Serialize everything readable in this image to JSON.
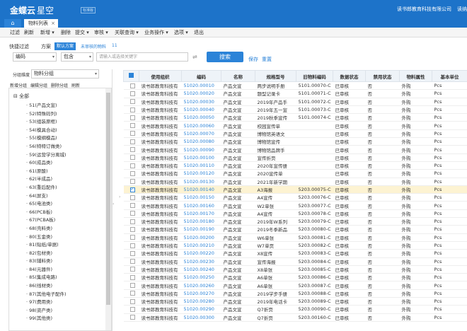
{
  "app": {
    "name": "金蝶云",
    "product": "星空",
    "badge": "标准版",
    "company": "读书郎教育科技有限公司",
    "user": "读纳"
  },
  "tabs": {
    "home": "⌂",
    "active": "物料列表",
    "close": "×"
  },
  "toolbar": [
    "过滤",
    "刷新",
    "新增 ▾",
    "删除",
    "提交 ▾",
    "审核 ▾",
    "关联查询 ▾",
    "业务操作 ▾",
    "选项 ▾",
    "退出"
  ],
  "filter": {
    "quick_filter": "快捷过滤",
    "scheme": "方案",
    "default_scheme": "默认方案",
    "unaudited": "未审核的物料",
    "count": "11",
    "field": "编码",
    "operator": "包含",
    "placeholder": "请输入或选择关键字",
    "search_button": "搜索",
    "save": "保存",
    "reset": "重置"
  },
  "left_panel": {
    "group_label": "分组维度",
    "group_value": "物料分组",
    "actions": [
      "新增分组",
      "编辑分组",
      "删除分组",
      "刷新"
    ],
    "root": "全部",
    "items": [
      "51(产品文宣)",
      "52(特殊码列)",
      "53(组装原框)",
      "54(模具合动)",
      "55(模纲模品)",
      "56(特特订做类)",
      "59(运营学分离城)",
      "60(成品类)",
      "61(原酸)",
      "62(半成品)",
      "63(重后配件)",
      "64(屏支)",
      "65(电池类)",
      "66(PCB板)",
      "67(PCBA板)",
      "68(壳料类)",
      "80(五金类)",
      "81(贴纸/单据)",
      "82(包材类)",
      "83(辅料类)",
      "84(元器件)",
      "85(集成电路)",
      "86(线材类)",
      "87(其他电子配件)",
      "97(费用类)",
      "98(资产类)",
      "99(其他类)"
    ]
  },
  "table": {
    "columns": [
      "",
      "使用组织",
      "编码",
      "名称",
      "规格型号",
      "旧物料编码",
      "数据状态",
      "禁用状态",
      "物料属性",
      "基本单位"
    ],
    "rows": [
      [
        "读书郎教育科技有",
        "51020.00010",
        "产品文宣",
        "两步说明手册",
        "5101.00070-C",
        "已审核",
        "否",
        "外购",
        "Pcs"
      ],
      [
        "读书郎教育科技有",
        "51020.00020",
        "产品文宣",
        "题型记录卡",
        "5101.00071-C",
        "已审核",
        "否",
        "外购",
        "Pcs"
      ],
      [
        "读书郎教育科技有",
        "51020.00030",
        "产品文宣",
        "2019年产品手",
        "5101.00072-C",
        "已审核",
        "否",
        "外购",
        "Pcs"
      ],
      [
        "读书郎教育科技有",
        "51020.00040",
        "产品文宣",
        "2019年五一宣",
        "5101.00073-C",
        "已审核",
        "否",
        "外购",
        "Pcs"
      ],
      [
        "读书郎教育科技有",
        "51020.00050",
        "产品文宣",
        "2019秋季宣传",
        "5101.00074-C",
        "已审核",
        "否",
        "外购",
        "Pcs"
      ],
      [
        "读书郎教育科技有",
        "51020.00060",
        "产品文宣",
        "校园宣传单",
        "",
        "已审核",
        "否",
        "外购",
        "Pcs"
      ],
      [
        "读书郎教育科技有",
        "51020.00070",
        "产品文宣",
        "博物馆英语文",
        "",
        "已审核",
        "否",
        "外购",
        "Pcs"
      ],
      [
        "读书郎教育科技有",
        "51020.00080",
        "产品文宣",
        "博物馆宣传",
        "",
        "已审核",
        "否",
        "外购",
        "Pcs"
      ],
      [
        "读书郎教育科技有",
        "51020.00090",
        "产品文宣",
        "博物馆品牌手",
        "",
        "已审核",
        "否",
        "外购",
        "Pcs"
      ],
      [
        "读书郎教育科技有",
        "51020.00100",
        "产品文宣",
        "宣传折页",
        "",
        "已审核",
        "否",
        "外购",
        "Pcs"
      ],
      [
        "读书郎教育科技有",
        "51020.00110",
        "产品文宣",
        "2020年宣传册",
        "",
        "已审核",
        "否",
        "外购",
        "Pcs"
      ],
      [
        "读书郎教育科技有",
        "51020.00120",
        "产品文宣",
        "2020宣传单",
        "",
        "已审核",
        "否",
        "外购",
        "Pcs"
      ],
      [
        "读书郎教育科技有",
        "51020.00130",
        "产品文宣",
        "2021年新学期",
        "",
        "已审核",
        "否",
        "外购",
        "Pcs"
      ],
      [
        "读书郎教育科技有",
        "51020.00140",
        "产品文宣",
        "A3海报",
        "5203.00075-C",
        "已审核",
        "否",
        "外购",
        "Pcs"
      ],
      [
        "读书郎教育科技有",
        "51020.00150",
        "产品文宣",
        "A4宣传",
        "5203.00076-C",
        "已审核",
        "否",
        "外购",
        "Pcs"
      ],
      [
        "读书郎教育科技有",
        "51020.00160",
        "产品文宣",
        "W2单张",
        "5203.00077-C",
        "已审核",
        "否",
        "外购",
        "Pcs"
      ],
      [
        "读书郎教育科技有",
        "51020.00170",
        "产品文宣",
        "A4宣传",
        "5203.00078-C",
        "已审核",
        "否",
        "外购",
        "Pcs"
      ],
      [
        "读书郎教育科技有",
        "51020.00180",
        "产品文宣",
        "2019年W系列",
        "5203.00079-C",
        "已审核",
        "否",
        "外购",
        "Pcs"
      ],
      [
        "读书郎教育科技有",
        "51020.00190",
        "产品文宣",
        "2019冬季新品",
        "5203.00080-C",
        "已审核",
        "否",
        "外购",
        "Pcs"
      ],
      [
        "读书郎教育科技有",
        "51020.00200",
        "产品文宣",
        "W6单张",
        "5203.00081-C",
        "已审核",
        "否",
        "外购",
        "Pcs"
      ],
      [
        "读书郎教育科技有",
        "51020.00210",
        "产品文宣",
        "W7单页",
        "5203.00082-C",
        "已审核",
        "否",
        "外购",
        "Pcs"
      ],
      [
        "读书郎教育科技有",
        "51020.00220",
        "产品文宣",
        "X8宣传",
        "5203.00083-C",
        "已审核",
        "否",
        "外购",
        "Pcs"
      ],
      [
        "读书郎教育科技有",
        "51020.00230",
        "产品文宣",
        "宣传海报",
        "5203.00084-C",
        "已审核",
        "否",
        "外购",
        "Pcs"
      ],
      [
        "读书郎教育科技有",
        "51020.00240",
        "产品文宣",
        "X8单张",
        "5203.00085-C",
        "已审核",
        "否",
        "外购",
        "Pcs"
      ],
      [
        "读书郎教育科技有",
        "51020.00250",
        "产品文宣",
        "A6单张",
        "5203.00086-C",
        "已审核",
        "否",
        "外购",
        "Pcs"
      ],
      [
        "读书郎教育科技有",
        "51020.00260",
        "产品文宣",
        "A6单张",
        "5203.00087-C",
        "已审核",
        "否",
        "外购",
        "Pcs"
      ],
      [
        "读书郎教育科技有",
        "51020.00270",
        "产品文宣",
        "2019学步手册",
        "5203.00088-C",
        "已审核",
        "否",
        "外购",
        "Pcs"
      ],
      [
        "读书郎教育科技有",
        "51020.00280",
        "产品文宣",
        "2019年电话卡",
        "5203.00089-C",
        "已审核",
        "否",
        "外购",
        "Pcs"
      ],
      [
        "读书郎教育科技有",
        "51020.00290",
        "产品文宣",
        "Q7折页",
        "5203.00090-C",
        "已审核",
        "否",
        "外购",
        "Pcs"
      ],
      [
        "读书郎教育科技有",
        "51020.00300",
        "产品文宣",
        "Q7折页",
        "5203.00160-C",
        "已审核",
        "否",
        "外购",
        "Pcs"
      ]
    ]
  }
}
